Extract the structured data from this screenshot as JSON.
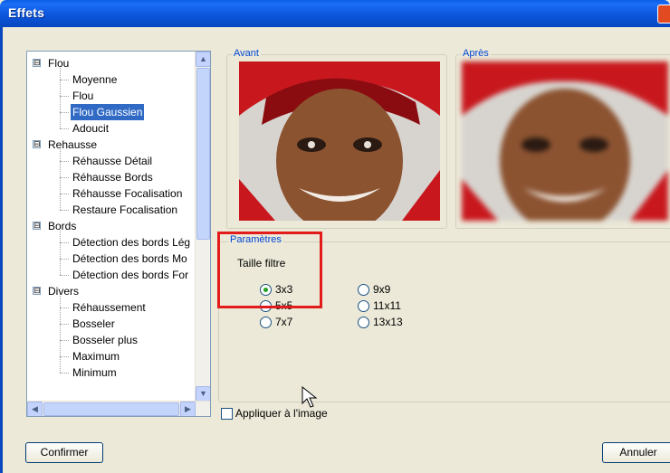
{
  "window": {
    "title": "Effets"
  },
  "tree": {
    "categories": [
      {
        "label": "Flou",
        "children": [
          "Moyenne",
          "Flou",
          "Flou Gaussien",
          "Adoucit"
        ]
      },
      {
        "label": "Rehausse",
        "children": [
          "Réhausse Détail",
          "Réhausse Bords",
          "Réhausse Focalisation",
          "Restaure Focalisation"
        ]
      },
      {
        "label": "Bords",
        "children": [
          "Détection des bords Lég",
          "Détection des bords Mo",
          "Détection des bords For"
        ]
      },
      {
        "label": "Divers",
        "children": [
          "Réhaussement",
          "Bosseler",
          "Bosseler plus",
          "Maximum",
          "Minimum"
        ]
      }
    ],
    "selected": "Flou Gaussien",
    "expand_symbol": "⊟"
  },
  "preview": {
    "before_label": "Avant",
    "after_label": "Après"
  },
  "params": {
    "legend": "Paramètres",
    "filter_label": "Taille filtre",
    "options": [
      "3x3",
      "5x5",
      "7x7",
      "9x9",
      "11x11",
      "13x13"
    ],
    "selected": "3x3"
  },
  "apply_checkbox": {
    "label": "Appliquer à l'image",
    "checked": false
  },
  "buttons": {
    "confirm": "Confirmer",
    "cancel": "Annuler"
  },
  "colors": {
    "title_bar": "#0a54d9",
    "selection": "#316ac5",
    "highlight_box": "#e21b1b",
    "legend_text": "#0046d5"
  }
}
